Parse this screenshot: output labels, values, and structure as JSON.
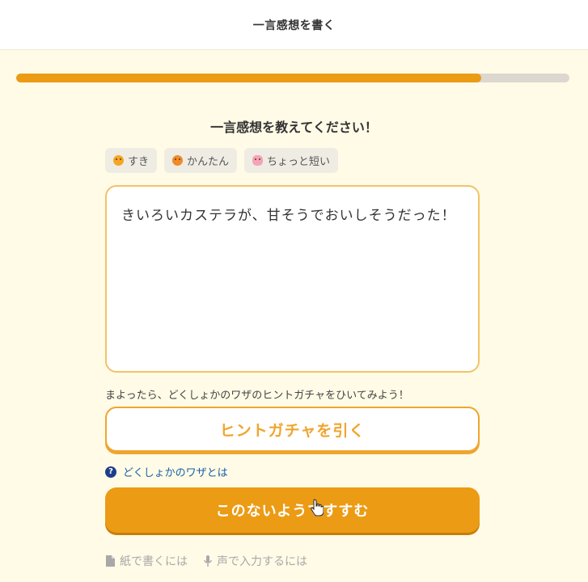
{
  "header": {
    "title": "一言感想を書く"
  },
  "progress": {
    "fraction": 0.84,
    "fill_color": "#ec9b15",
    "track_color": "#dcd8d0"
  },
  "question": {
    "text": "一言感想を教えてください！"
  },
  "chips": [
    {
      "label": "すき",
      "icon": "smile-emoji-icon"
    },
    {
      "label": "かんたん",
      "icon": "tongue-emoji-icon"
    },
    {
      "label": "ちょっと短い",
      "icon": "pig-emoji-icon"
    }
  ],
  "textbox": {
    "value": "きいろいカステラが、甘そうでおいしそうだった！"
  },
  "hint": {
    "text": "まよったら、どくしょかのワザのヒントガチャをひいてみよう！"
  },
  "gacha_button": {
    "label": "ヒントガチャを引く"
  },
  "waza_link": {
    "label": "どくしょかのワザとは",
    "icon": "help-circle-icon"
  },
  "next_button": {
    "label": "このないようですすむ"
  },
  "footer": {
    "paper_link": {
      "label": "紙で書くには",
      "icon": "document-icon"
    },
    "voice_link": {
      "label": "声で入力するには",
      "icon": "microphone-icon"
    }
  },
  "colors": {
    "accent": "#ec9b15",
    "background": "#fffbe7",
    "link": "#1a5fa8"
  }
}
